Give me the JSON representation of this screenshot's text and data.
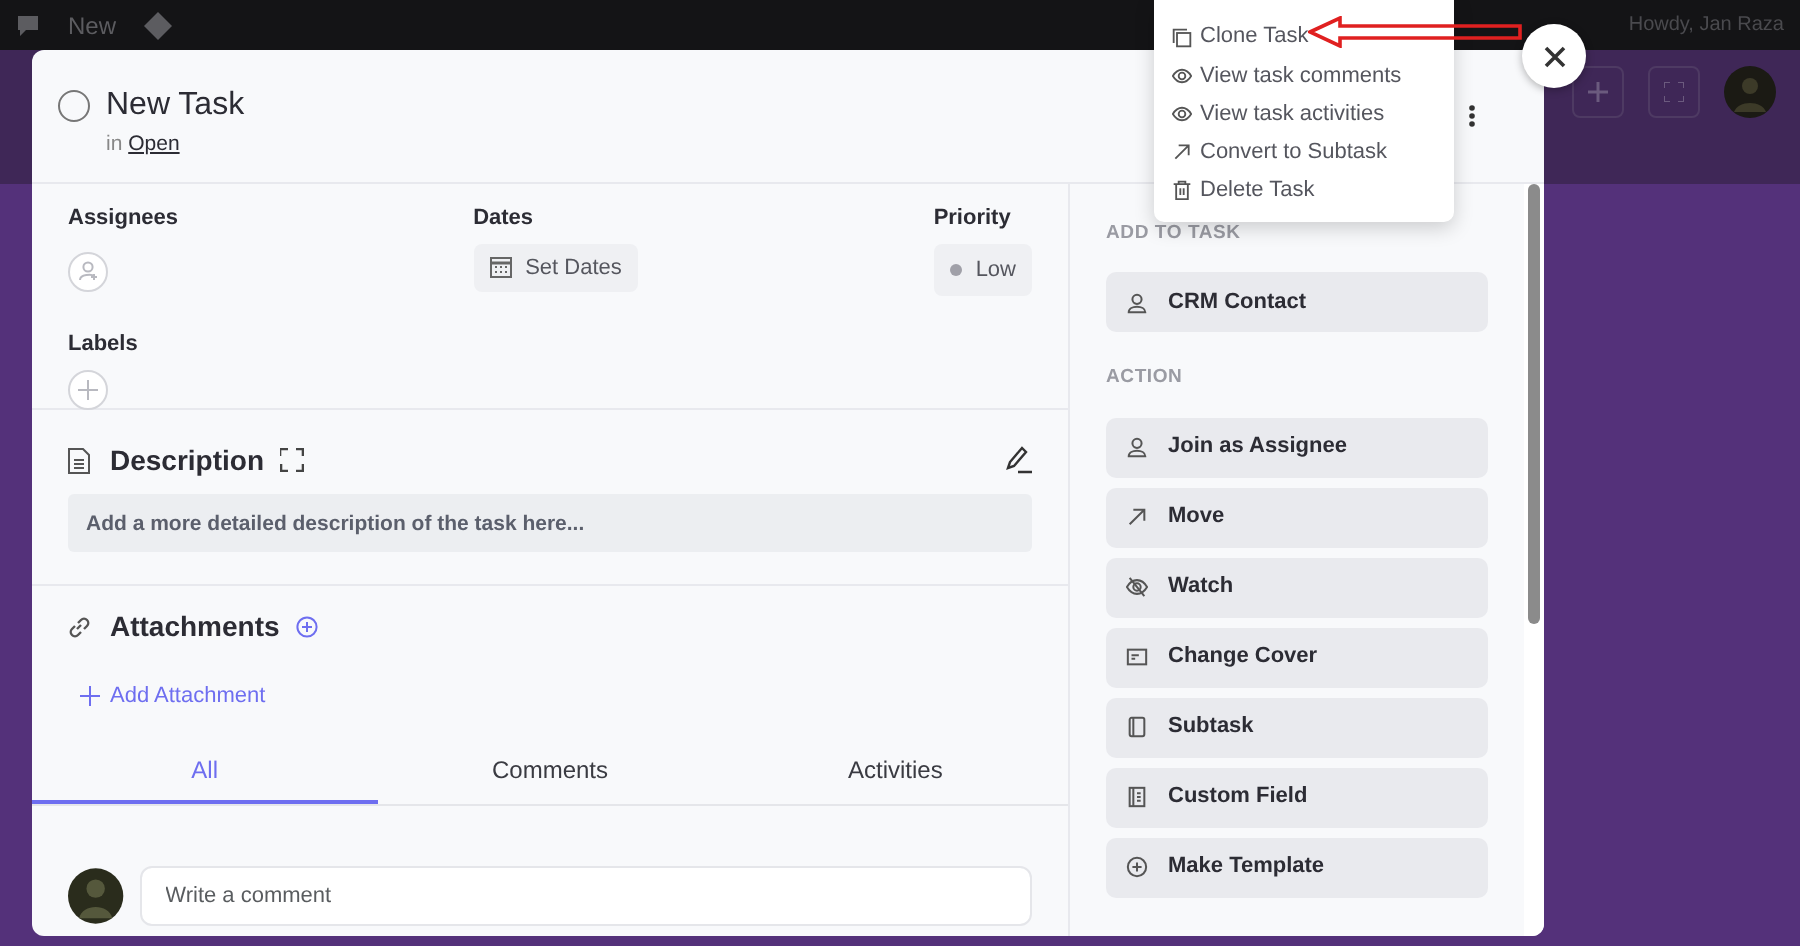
{
  "admin_bar": {
    "new_label": "New",
    "greeting": "Howdy, Jan Raza"
  },
  "task": {
    "title": "New Task",
    "completed": false,
    "in_label": "in",
    "stage": "Open"
  },
  "fields": {
    "assignees_label": "Assignees",
    "dates_label": "Dates",
    "dates_button": "Set Dates",
    "priority_label": "Priority",
    "priority": "Low",
    "labels_label": "Labels"
  },
  "description": {
    "title": "Description",
    "prompt": "Add a more detailed description of the task here..."
  },
  "attachments": {
    "title": "Attachments",
    "add_link": "Add Attachment"
  },
  "tabs": [
    {
      "label": "All",
      "selected": true
    },
    {
      "label": "Comments",
      "selected": false
    },
    {
      "label": "Activities",
      "selected": false
    }
  ],
  "comment": {
    "placeholder": "Write a comment"
  },
  "sidebar": [
    {
      "title": "ADD TO TASK",
      "buttons": [
        {
          "label": "CRM Contact"
        }
      ]
    },
    {
      "title": "ACTION",
      "buttons": [
        {
          "label": "Join as Assignee"
        },
        {
          "label": "Move"
        },
        {
          "label": "Watch"
        },
        {
          "label": "Change Cover"
        },
        {
          "label": "Subtask"
        },
        {
          "label": "Custom Field"
        },
        {
          "label": "Make Template"
        }
      ]
    }
  ],
  "menu": [
    {
      "label": "Clone Task"
    },
    {
      "label": "View task comments"
    },
    {
      "label": "View task activities"
    },
    {
      "label": "Convert to Subtask"
    },
    {
      "label": "Delete Task"
    }
  ]
}
